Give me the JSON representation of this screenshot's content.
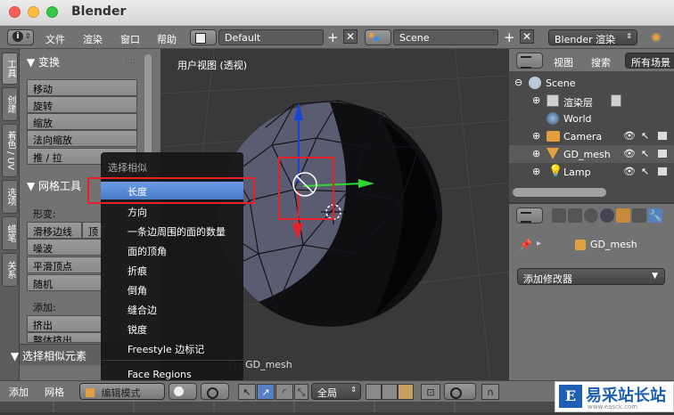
{
  "app": {
    "title": "Blender"
  },
  "topbar": {
    "menus": [
      "文件",
      "渲染",
      "窗口",
      "帮助"
    ],
    "layout": "Default",
    "scene": "Scene",
    "engine": "Blender 渲染"
  },
  "toolshelf": {
    "tabs": [
      "工具",
      "创建",
      "着色 / UV",
      "选项",
      "蜡笔",
      "关系"
    ],
    "transform": {
      "title": "变换",
      "buttons": [
        "移动",
        "旋转",
        "缩放",
        "法向缩放",
        "推 / 拉"
      ]
    },
    "mesh_tools": {
      "title": "网格工具",
      "deform_label": "形变:",
      "slide_edge": "滑移边线",
      "vertex_partial": "顶点",
      "noise": "噪波",
      "smooth_vertex": "平滑顶点",
      "random": "随机",
      "add_label": "添加:",
      "extrude": "挤出",
      "extrude_region": "整体挤出"
    },
    "operator_panel": "选择相似元素"
  },
  "viewport": {
    "label": "用户视图 (透视)",
    "object_label": "(1) GD_mesh"
  },
  "popup": {
    "title": "选择相似",
    "items": [
      "长度",
      "方向",
      "一条边周围的面的数量",
      "面的顶角",
      "折痕",
      "倒角",
      "缝合边",
      "锐度",
      "Freestyle 边标记",
      "Face Regions"
    ]
  },
  "outliner": {
    "menu_view": "视图",
    "menu_search": "搜索",
    "filter": "所有场景",
    "items": [
      "Scene",
      "渲染层",
      "World",
      "Camera",
      "GD_mesh",
      "Lamp"
    ]
  },
  "properties": {
    "object": "GD_mesh",
    "add_modifier": "添加修改器"
  },
  "bottombar": {
    "add": "添加",
    "mesh": "网格",
    "mode": "编辑模式",
    "pivot": "全局"
  },
  "watermark": {
    "text": "易采站长站",
    "sub": "www.easck.com"
  },
  "colors": {
    "accent": "#5680c2",
    "highlight_box": "#e8202a",
    "gizmo_x": "#e8202a",
    "gizmo_y": "#2fd62f",
    "gizmo_z": "#1a44d6"
  }
}
